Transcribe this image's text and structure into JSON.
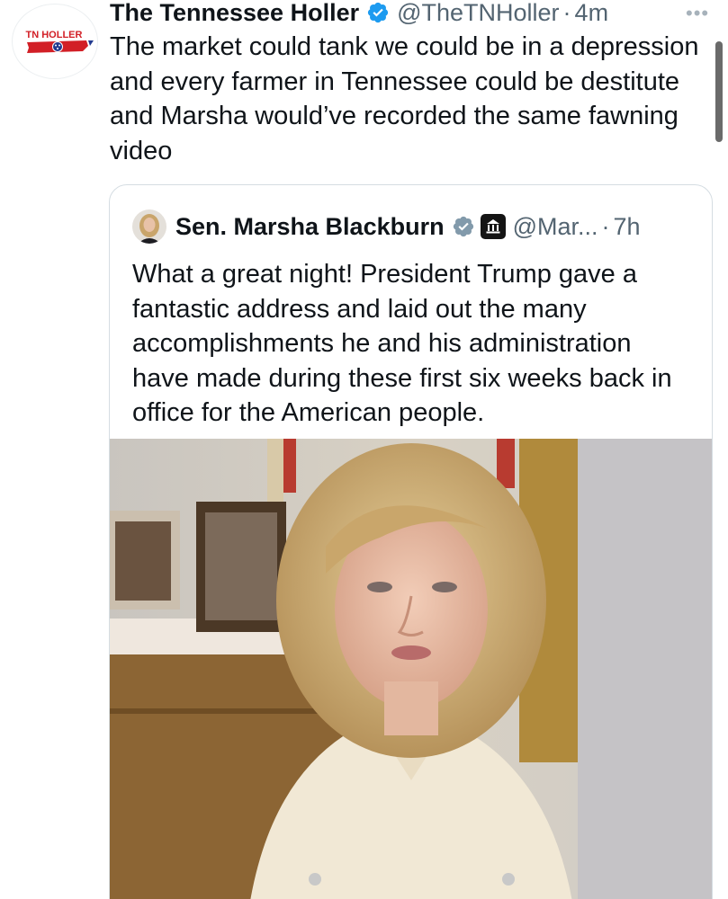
{
  "tweet": {
    "avatar_logo_text": "TN HOLLER",
    "display_name": "The Tennessee Holler",
    "handle": "@TheTNHoller",
    "separator": "·",
    "time": "4m",
    "more_icon": "more-icon",
    "text": "The market could tank we could be in a depression and every farmer in Tennessee could be destitute and Marsha would’ve recorded the same fawning video"
  },
  "quote": {
    "display_name": "Sen. Marsha Blackburn",
    "handle": "@Mar...",
    "separator": "·",
    "time": "7h",
    "verified_color": "#829aab",
    "text": "What a great night! President Trump gave a fantastic address and laid out the many accomplishments he and his administration have made during these first six weeks back in office for the American people.",
    "media_description_icon": "video-thumbnail"
  },
  "colors": {
    "verified_blue": "#1d9bf0",
    "secondary_text": "#536471",
    "brand_red": "#d21f26",
    "brand_blue": "#213a8f"
  }
}
